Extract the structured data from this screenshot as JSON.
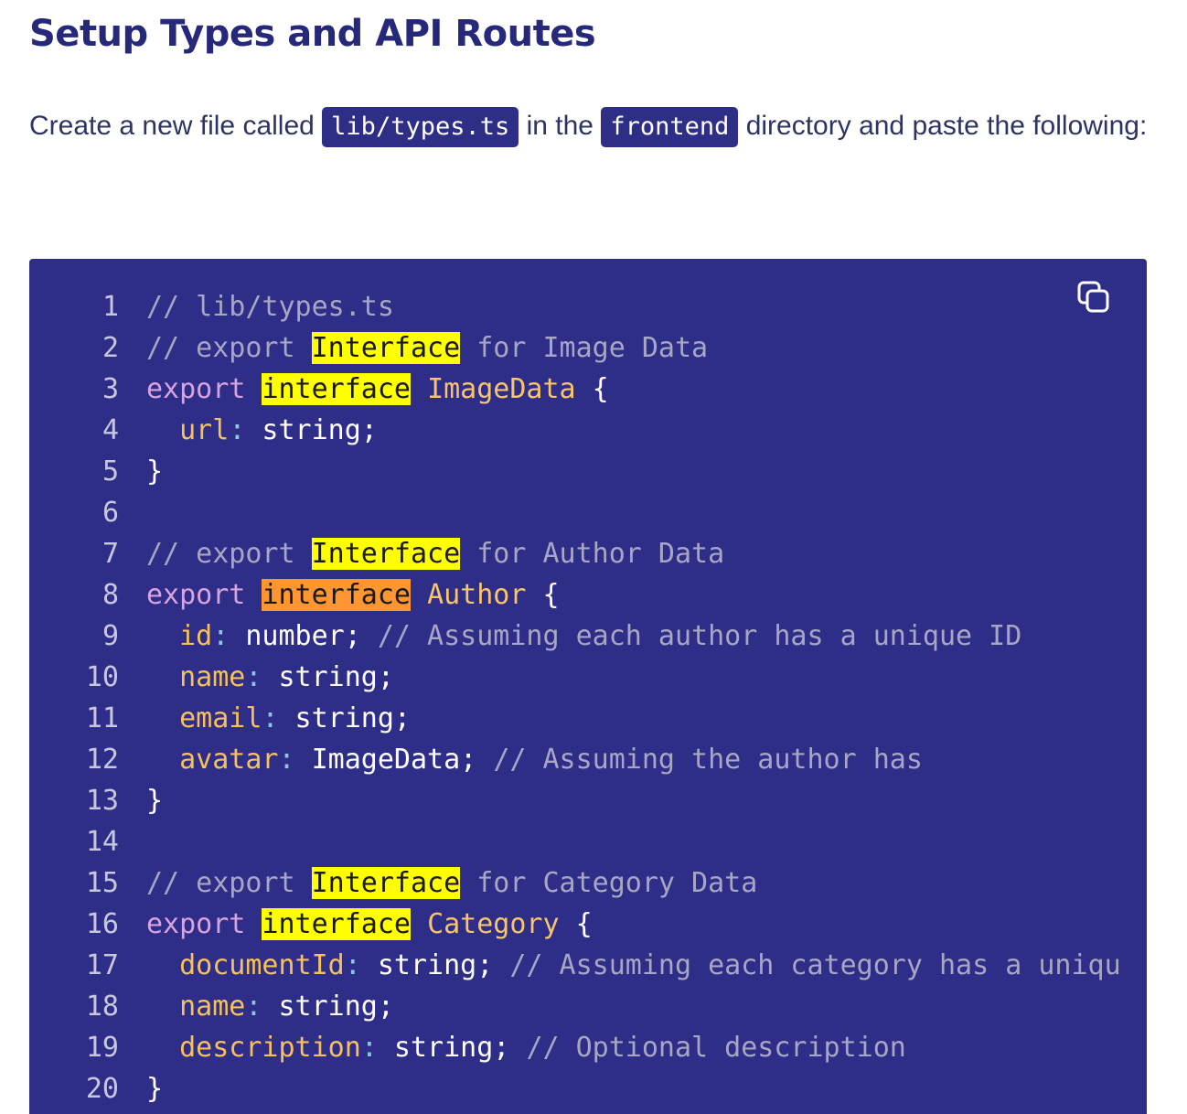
{
  "heading": "Setup Types and API Routes",
  "intro": {
    "part1": "Create a new file called ",
    "chip1": "lib/types.ts",
    "part2": " in the ",
    "chip2": "frontend",
    "part3": " directory and paste the following:"
  },
  "code": {
    "copy_icon": "copy-icon",
    "lines": [
      {
        "n": "1",
        "tokens": [
          {
            "t": "// lib/types.ts",
            "c": "cm"
          }
        ]
      },
      {
        "n": "2",
        "tokens": [
          {
            "t": "// export ",
            "c": "cm"
          },
          {
            "t": "Interface",
            "c": "hl"
          },
          {
            "t": " for Image Data",
            "c": "cm"
          }
        ]
      },
      {
        "n": "3",
        "tokens": [
          {
            "t": "export",
            "c": "kw"
          },
          {
            "t": " ",
            "c": "pl"
          },
          {
            "t": "interface",
            "c": "hl"
          },
          {
            "t": " ",
            "c": "pl"
          },
          {
            "t": "ImageData",
            "c": "ty"
          },
          {
            "t": " {",
            "c": "pl"
          }
        ]
      },
      {
        "n": "4",
        "tokens": [
          {
            "t": "  ",
            "c": "pl"
          },
          {
            "t": "url",
            "c": "pr"
          },
          {
            "t": ":",
            "c": "pn"
          },
          {
            "t": " string;",
            "c": "pl"
          }
        ]
      },
      {
        "n": "5",
        "tokens": [
          {
            "t": "}",
            "c": "pl"
          }
        ]
      },
      {
        "n": "6",
        "tokens": []
      },
      {
        "n": "7",
        "tokens": [
          {
            "t": "// export ",
            "c": "cm"
          },
          {
            "t": "Interface",
            "c": "hl"
          },
          {
            "t": " for Author Data",
            "c": "cm"
          }
        ]
      },
      {
        "n": "8",
        "tokens": [
          {
            "t": "export",
            "c": "kw"
          },
          {
            "t": " ",
            "c": "pl"
          },
          {
            "t": "interface",
            "c": "hl2"
          },
          {
            "t": " ",
            "c": "pl"
          },
          {
            "t": "Author",
            "c": "ty"
          },
          {
            "t": " {",
            "c": "pl"
          }
        ]
      },
      {
        "n": "9",
        "tokens": [
          {
            "t": "  ",
            "c": "pl"
          },
          {
            "t": "id",
            "c": "pr"
          },
          {
            "t": ":",
            "c": "pn"
          },
          {
            "t": " number; ",
            "c": "pl"
          },
          {
            "t": "// Assuming each author has a unique ID",
            "c": "cm"
          }
        ]
      },
      {
        "n": "10",
        "tokens": [
          {
            "t": "  ",
            "c": "pl"
          },
          {
            "t": "name",
            "c": "pr"
          },
          {
            "t": ":",
            "c": "pn"
          },
          {
            "t": " string;",
            "c": "pl"
          }
        ]
      },
      {
        "n": "11",
        "tokens": [
          {
            "t": "  ",
            "c": "pl"
          },
          {
            "t": "email",
            "c": "pr"
          },
          {
            "t": ":",
            "c": "pn"
          },
          {
            "t": " string;",
            "c": "pl"
          }
        ]
      },
      {
        "n": "12",
        "tokens": [
          {
            "t": "  ",
            "c": "pl"
          },
          {
            "t": "avatar",
            "c": "pr"
          },
          {
            "t": ":",
            "c": "pn"
          },
          {
            "t": " ImageData; ",
            "c": "pl"
          },
          {
            "t": "// Assuming the author has",
            "c": "cm"
          }
        ]
      },
      {
        "n": "13",
        "tokens": [
          {
            "t": "}",
            "c": "pl"
          }
        ]
      },
      {
        "n": "14",
        "tokens": []
      },
      {
        "n": "15",
        "tokens": [
          {
            "t": "// export ",
            "c": "cm"
          },
          {
            "t": "Interface",
            "c": "hl"
          },
          {
            "t": " for Category Data",
            "c": "cm"
          }
        ]
      },
      {
        "n": "16",
        "tokens": [
          {
            "t": "export",
            "c": "kw"
          },
          {
            "t": " ",
            "c": "pl"
          },
          {
            "t": "interface",
            "c": "hl"
          },
          {
            "t": " ",
            "c": "pl"
          },
          {
            "t": "Category",
            "c": "ty"
          },
          {
            "t": " {",
            "c": "pl"
          }
        ]
      },
      {
        "n": "17",
        "tokens": [
          {
            "t": "  ",
            "c": "pl"
          },
          {
            "t": "documentId",
            "c": "pr"
          },
          {
            "t": ":",
            "c": "pn"
          },
          {
            "t": " string; ",
            "c": "pl"
          },
          {
            "t": "// Assuming each category has a uniqu",
            "c": "cm"
          }
        ]
      },
      {
        "n": "18",
        "tokens": [
          {
            "t": "  ",
            "c": "pl"
          },
          {
            "t": "name",
            "c": "pr"
          },
          {
            "t": ":",
            "c": "pn"
          },
          {
            "t": " string;",
            "c": "pl"
          }
        ]
      },
      {
        "n": "19",
        "tokens": [
          {
            "t": "  ",
            "c": "pl"
          },
          {
            "t": "description",
            "c": "pr"
          },
          {
            "t": ":",
            "c": "pn"
          },
          {
            "t": " string; ",
            "c": "pl"
          },
          {
            "t": "// Optional description",
            "c": "cm"
          }
        ]
      },
      {
        "n": "20",
        "tokens": [
          {
            "t": "}",
            "c": "pl"
          }
        ]
      }
    ]
  },
  "colors": {
    "heading": "#26287a",
    "code_bg": "#2e2d88",
    "chip_bg": "#2e2e87",
    "search_highlight": "#ffff00",
    "active_highlight": "#ff9632"
  }
}
